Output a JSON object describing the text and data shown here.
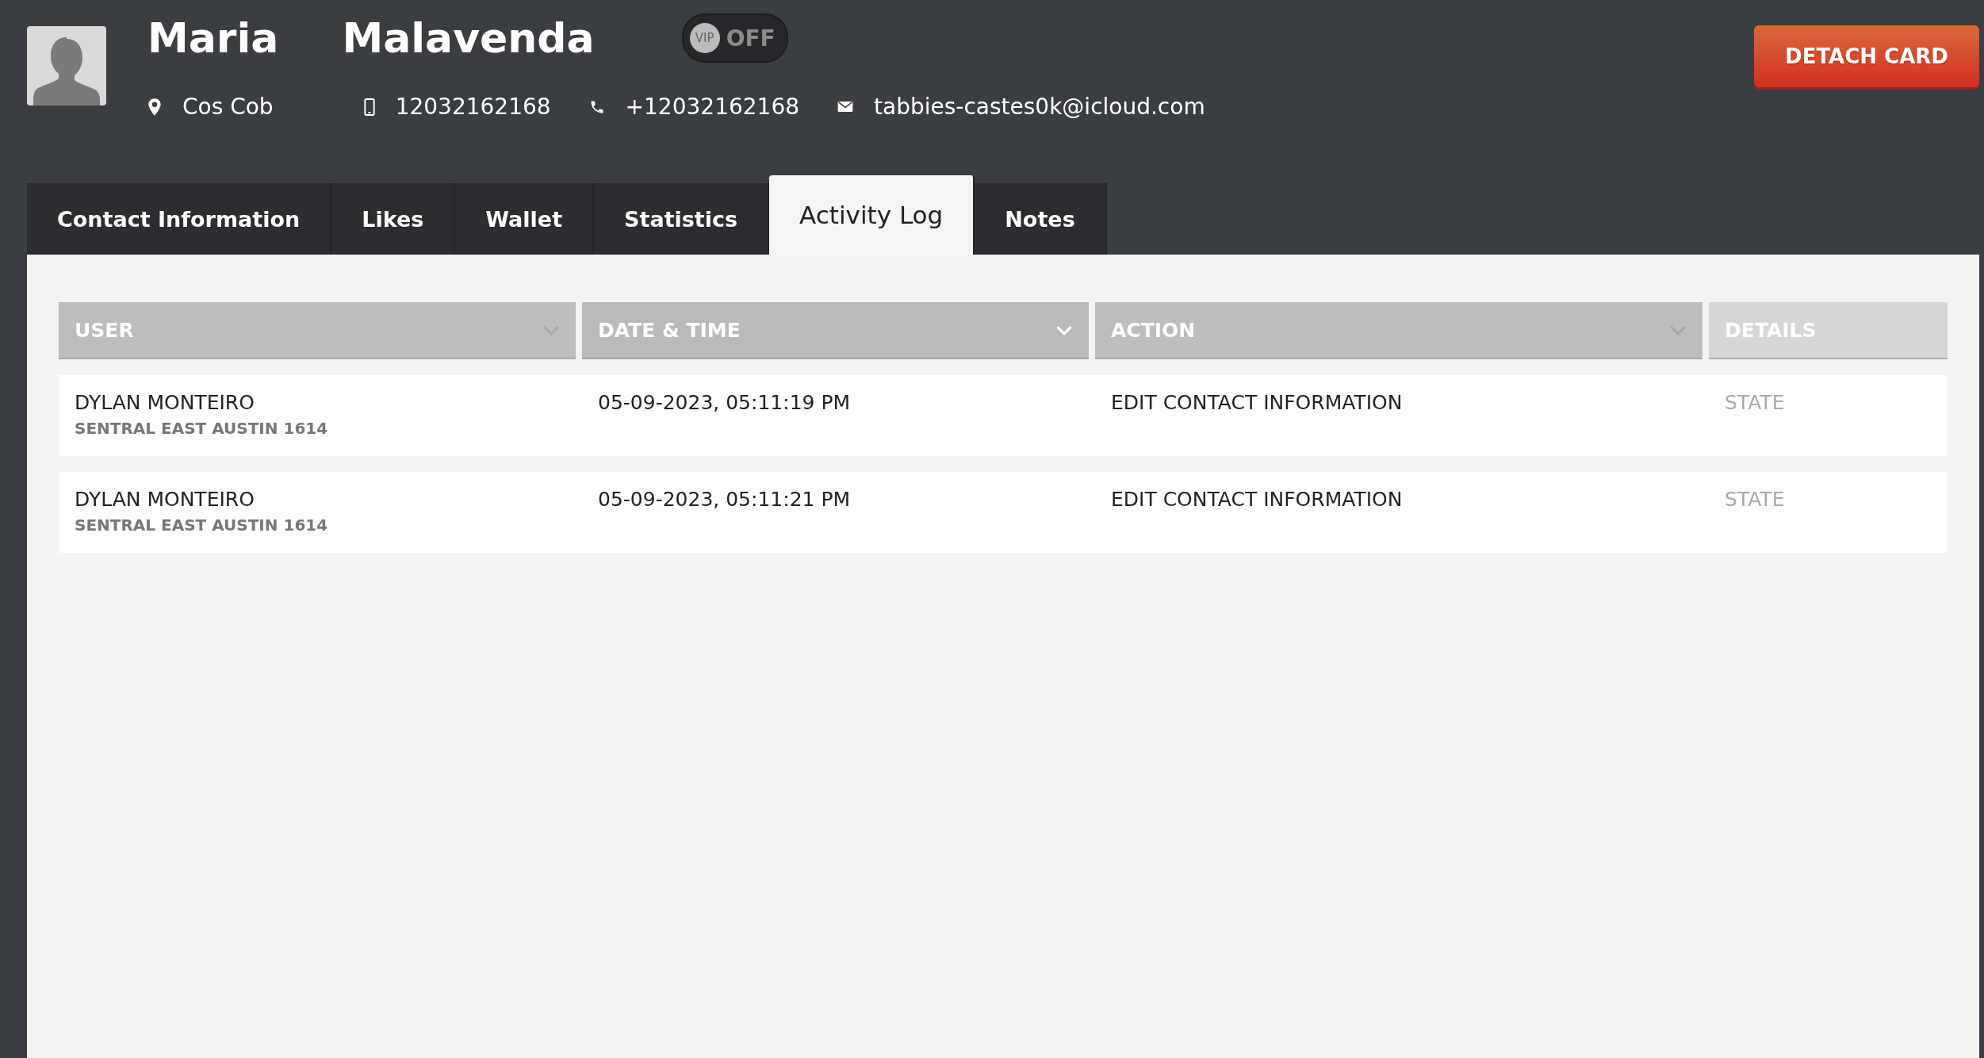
{
  "contact": {
    "first_name": "Maria",
    "last_name": "Malavenda",
    "vip": {
      "label": "VIP",
      "state_text": "OFF",
      "on": false
    },
    "details": [
      {
        "kind": "location",
        "text": "Cos Cob"
      },
      {
        "kind": "mobile",
        "text": "12032162168"
      },
      {
        "kind": "phone",
        "text": "+12032162168"
      },
      {
        "kind": "email",
        "text": "tabbies-castes0k@icloud.com"
      }
    ]
  },
  "detach_button": "DETACH CARD",
  "tabs": [
    {
      "label": "Contact Information",
      "selected": false
    },
    {
      "label": "Likes",
      "selected": false
    },
    {
      "label": "Wallet",
      "selected": false
    },
    {
      "label": "Statistics",
      "selected": false
    },
    {
      "label": "Activity Log",
      "selected": true
    },
    {
      "label": "Notes",
      "selected": false
    }
  ],
  "table": {
    "columns": [
      {
        "label": "USER",
        "sortable": true,
        "sorted": false
      },
      {
        "label": "DATE & TIME",
        "sortable": true,
        "sorted": true
      },
      {
        "label": "ACTION",
        "sortable": true,
        "sorted": false
      },
      {
        "label": "DETAILS",
        "sortable": false,
        "sorted": false
      }
    ],
    "rows": [
      {
        "user": "DYLAN MONTEIRO",
        "location": "SENTRAL EAST AUSTIN 1614",
        "datetime": "05-09-2023, 05:11:19 PM",
        "action": "EDIT CONTACT INFORMATION",
        "details": "STATE"
      },
      {
        "user": "DYLAN MONTEIRO",
        "location": "SENTRAL EAST AUSTIN 1614",
        "datetime": "05-09-2023, 05:11:21 PM",
        "action": "EDIT CONTACT INFORMATION",
        "details": "STATE"
      }
    ]
  }
}
